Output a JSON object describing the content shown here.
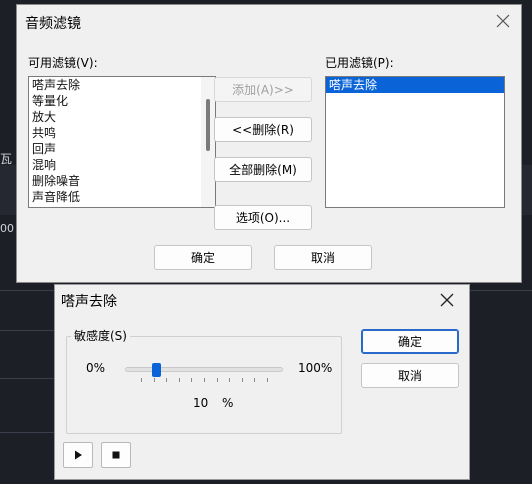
{
  "background": {
    "fragment_left": "瓦",
    "fragment_number": "00"
  },
  "filters_dialog": {
    "title": "音频滤镜",
    "available_label": "可用滤镜(V):",
    "available_filters": [
      "嗒声去除",
      "等量化",
      "放大",
      "共鸣",
      "回声",
      "混响",
      "删除噪音",
      "声音降低"
    ],
    "applied_label": "已用滤镜(P):",
    "applied_filters": [
      "嗒声去除"
    ],
    "buttons": {
      "add": "添加(A)>>",
      "remove": "<<删除(R)",
      "remove_all": "全部删除(M)",
      "options": "选项(O)..."
    },
    "ok": "确定",
    "cancel": "取消"
  },
  "declick_dialog": {
    "title": "嗒声去除",
    "sensitivity_label": "敏感度(S)",
    "min_label": "0%",
    "max_label": "100%",
    "value": "10",
    "value_unit": "%",
    "slider_fraction": 0.1,
    "ok": "确定",
    "cancel": "取消"
  },
  "colors": {
    "accent": "#0a64d8",
    "dialog_bg": "#f0f0f0",
    "app_bg": "#1d1f26"
  },
  "icons": [
    "close-icon",
    "play-icon",
    "stop-icon"
  ]
}
